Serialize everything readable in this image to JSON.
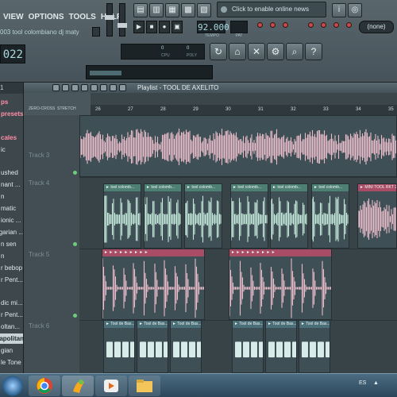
{
  "menu": [
    "VIEW",
    "OPTIONS",
    "TOOLS",
    "HELP"
  ],
  "song_title": "003   tool colombiano dj maty",
  "time_display": "022",
  "tempo": "92.000",
  "tempo_label": "TEMPO",
  "pattern_label": "PAT",
  "news": "Click to enable online news",
  "none_label": "(none)",
  "cpu": {
    "cpu_value": "0",
    "mem_value": "0",
    "cpu_label": "CPU",
    "poly_label": "POLY"
  },
  "transport": [
    "▶",
    "■",
    "●",
    "▣"
  ],
  "toolbar_icons": [
    "playlist-icon",
    "piano-roll-icon",
    "browser-icon",
    "mixer-icon",
    "channel-rack-icon",
    "plugin-icon"
  ],
  "round_buttons": [
    "↻",
    "⌂",
    "✕",
    "⚙",
    "⌕",
    "?"
  ],
  "browser": {
    "header": "1",
    "items": [
      {
        "label": "ps",
        "style": "hot"
      },
      {
        "label": "presets",
        "style": "hot"
      },
      {
        "label": "",
        "style": ""
      },
      {
        "label": "cales",
        "style": "hot"
      },
      {
        "label": "ic",
        "style": ""
      },
      {
        "label": "",
        "style": ""
      },
      {
        "label": "ushed",
        "style": ""
      },
      {
        "label": "nant ...",
        "style": ""
      },
      {
        "label": "n",
        "style": ""
      },
      {
        "label": "matic",
        "style": ""
      },
      {
        "label": "ionic ...",
        "style": ""
      },
      {
        "label": "garian ...",
        "style": ""
      },
      {
        "label": "n sen",
        "style": ""
      },
      {
        "label": "n",
        "style": ""
      },
      {
        "label": "r bebop",
        "style": ""
      },
      {
        "label": "r Pent...",
        "style": ""
      },
      {
        "label": "",
        "style": ""
      },
      {
        "label": "dic mi...",
        "style": ""
      },
      {
        "label": "r Pent...",
        "style": ""
      },
      {
        "label": "oltan...",
        "style": ""
      },
      {
        "label": "apolitan",
        "style": "sel"
      },
      {
        "label": "gian",
        "style": ""
      },
      {
        "label": "le Tone",
        "style": ""
      }
    ]
  },
  "playlist": {
    "title": "Playlist - TOOL DE AXELITO",
    "options": [
      "ZERO-CROSS",
      "STRETCH"
    ],
    "ruler_ticks": [
      "26",
      "27",
      "28",
      "29",
      "30",
      "31",
      "32",
      "33",
      "34",
      "35"
    ],
    "tracks": [
      "Track 3",
      "Track 4",
      "Track 5",
      "Track 6"
    ],
    "clip_labels": {
      "colombiano": "► tool colomb...",
      "mini": "► MINI TOOL RKT 2",
      "bass": "► Tool de Bas..."
    }
  },
  "colors": {
    "pink_wave": "#e8bcc9",
    "green_wave": "#c4e8d9",
    "bass_block": "#d7ebe9",
    "clip_bg": "#3e4f55",
    "clip_head_green": "#4d7f72",
    "clip_head_pink": "#a94d66",
    "clip_head_teal": "#4b6f78"
  },
  "taskbar": {
    "apps": [
      "start-button",
      "chrome-icon",
      "fl-studio-icon",
      "media-player-icon",
      "explorer-icon"
    ],
    "language": "ES"
  }
}
